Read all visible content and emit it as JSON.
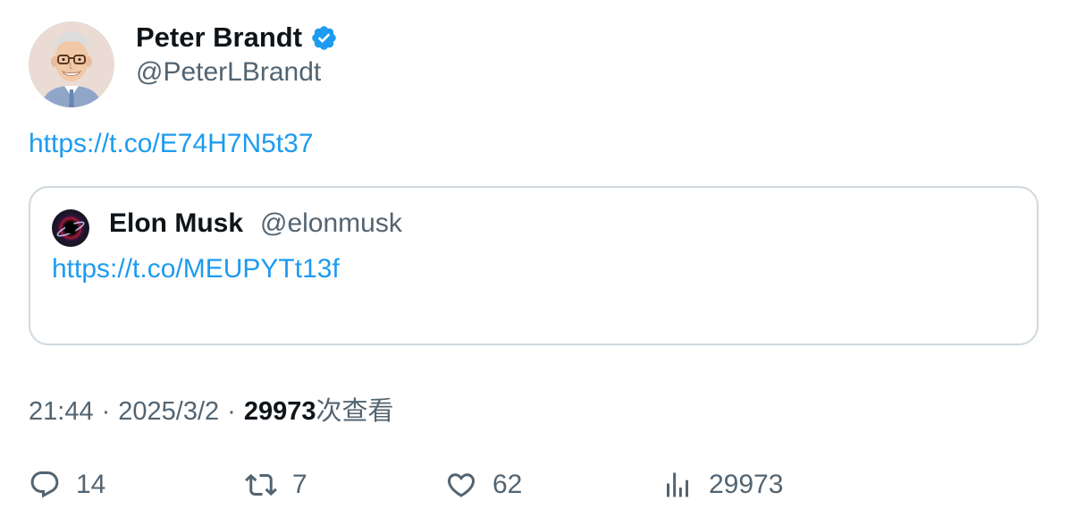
{
  "tweet": {
    "author": {
      "name": "Peter Brandt",
      "handle": "@PeterLBrandt",
      "verified_icon": "verified-badge-icon"
    },
    "link": "https://t.co/E74H7N5t37",
    "quote": {
      "name": "Elon Musk",
      "handle": "@elonmusk",
      "link": "https://t.co/MEUPYTt13f"
    },
    "meta": {
      "time": "21:44",
      "separator": "·",
      "date": "2025/3/2",
      "views_count": "29973",
      "views_label": "次查看"
    },
    "actions": {
      "replies": "14",
      "retweets": "7",
      "likes": "62",
      "views": "29973"
    }
  },
  "colors": {
    "link": "#1d9bf0",
    "secondary_text": "#536471",
    "primary_text": "#0f1419",
    "border": "#cfd9de",
    "verified": "#1d9bf0"
  }
}
